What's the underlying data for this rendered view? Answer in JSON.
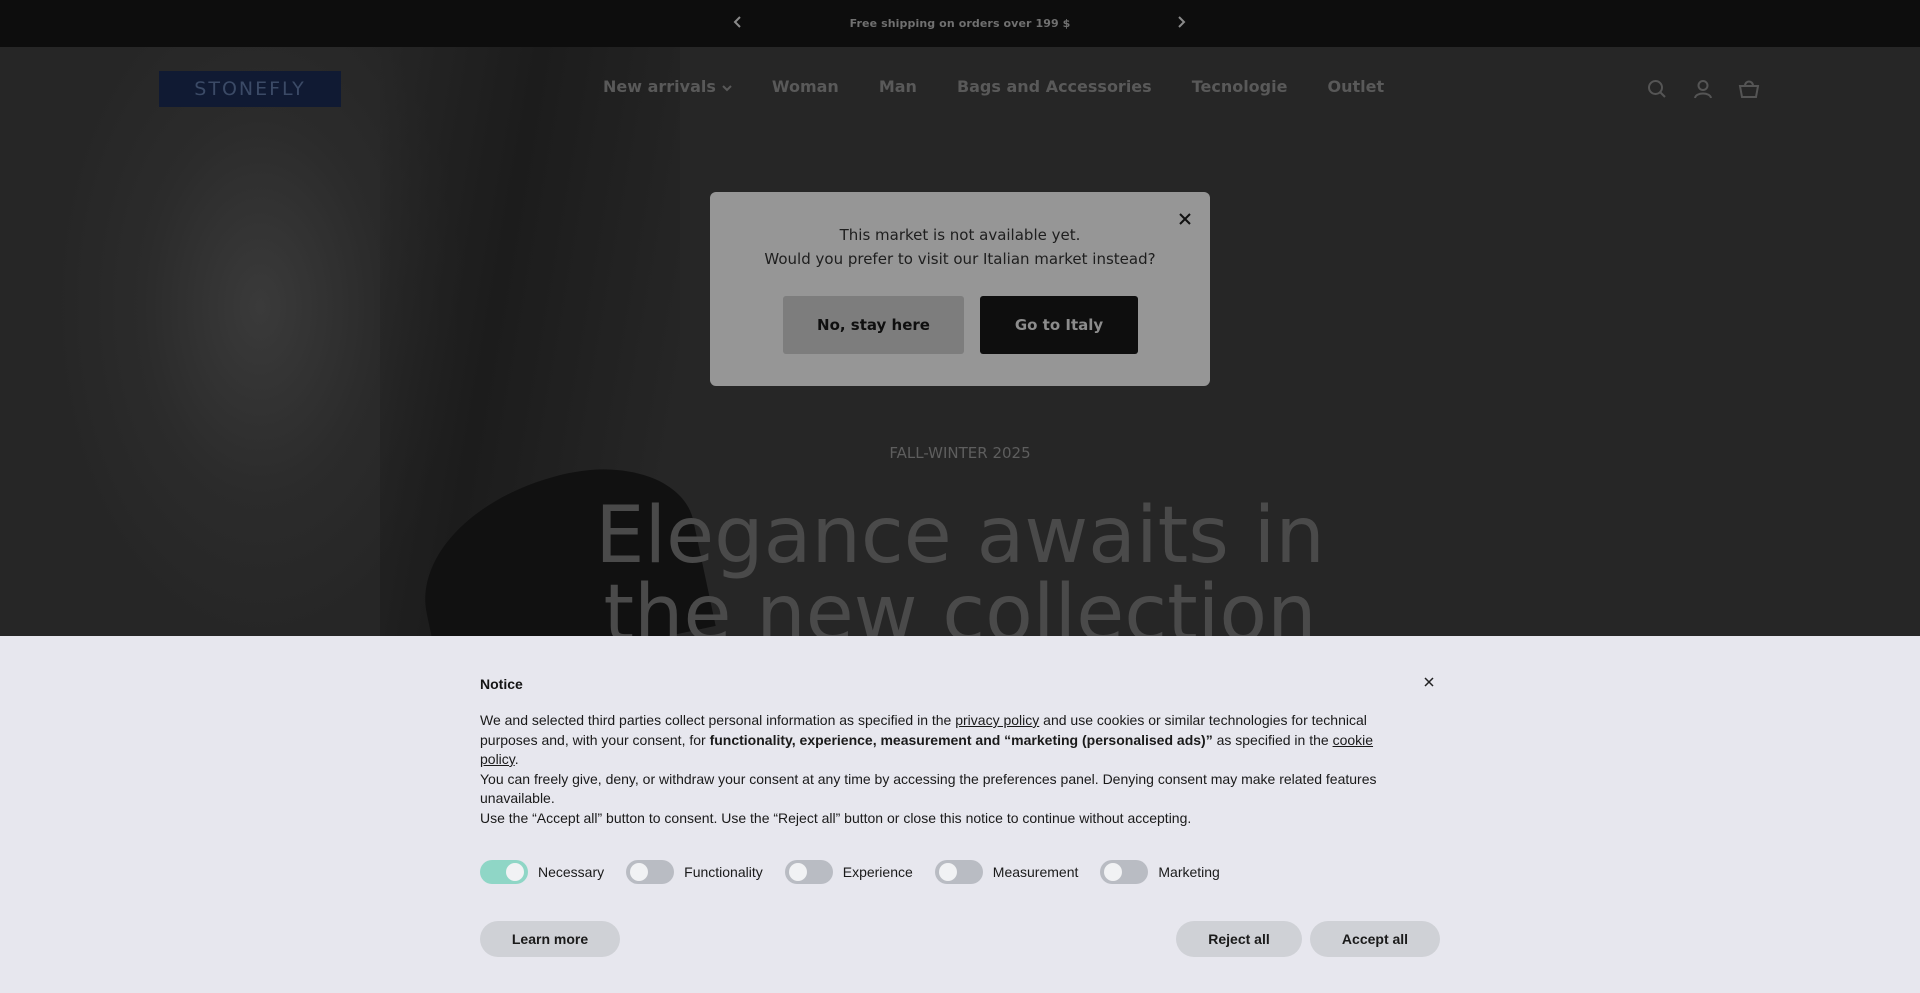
{
  "announcement": {
    "text": "Free shipping on orders over 199 $",
    "prev_icon": "chevron-left-icon",
    "next_icon": "chevron-right-icon"
  },
  "header": {
    "logo": "STONEFLY",
    "nav": [
      {
        "label": "New arrivals",
        "has_dropdown": true
      },
      {
        "label": "Woman"
      },
      {
        "label": "Man"
      },
      {
        "label": "Bags and Accessories"
      },
      {
        "label": "Tecnologie"
      },
      {
        "label": "Outlet"
      }
    ],
    "icons": [
      "search-icon",
      "account-icon",
      "cart-icon"
    ]
  },
  "hero": {
    "eyebrow": "FALL-WINTER 2025",
    "headline_line1": "Elegance awaits in",
    "headline_line2": "the new collection"
  },
  "market_modal": {
    "line1": "This market is not available yet.",
    "line2": "Would you prefer to visit our Italian market instead?",
    "stay_label": "No, stay here",
    "go_label": "Go to Italy"
  },
  "cookie": {
    "title": "Notice",
    "p1_a": "We and selected third parties collect personal information as specified in the ",
    "privacy_link": "privacy policy",
    "p1_b": " and use cookies or similar technologies for technical purposes and, with your consent, for ",
    "p1_bold": "functionality, experience, measurement and “marketing (personalised ads)”",
    "p1_c": " as specified in the ",
    "cookie_link": "cookie policy",
    "p1_d": ".",
    "p2": "You can freely give, deny, or withdraw your consent at any time by accessing the preferences panel. Denying consent may make related features unavailable.",
    "p3": "Use the “Accept all” button to consent. Use the “Reject all” button or close this notice to continue without accepting.",
    "toggles": [
      {
        "label": "Necessary",
        "on": true
      },
      {
        "label": "Functionality",
        "on": false
      },
      {
        "label": "Experience",
        "on": false
      },
      {
        "label": "Measurement",
        "on": false
      },
      {
        "label": "Marketing",
        "on": false
      }
    ],
    "learn_more": "Learn more",
    "reject_all": "Reject all",
    "accept_all": "Accept all"
  },
  "colors": {
    "announcement_bg": "#0d0d0d",
    "cookie_bg": "#e7e7ee",
    "toggle_on": "#8fd6c6",
    "toggle_off": "#b9bcc3",
    "modal_bg": "#969696"
  }
}
